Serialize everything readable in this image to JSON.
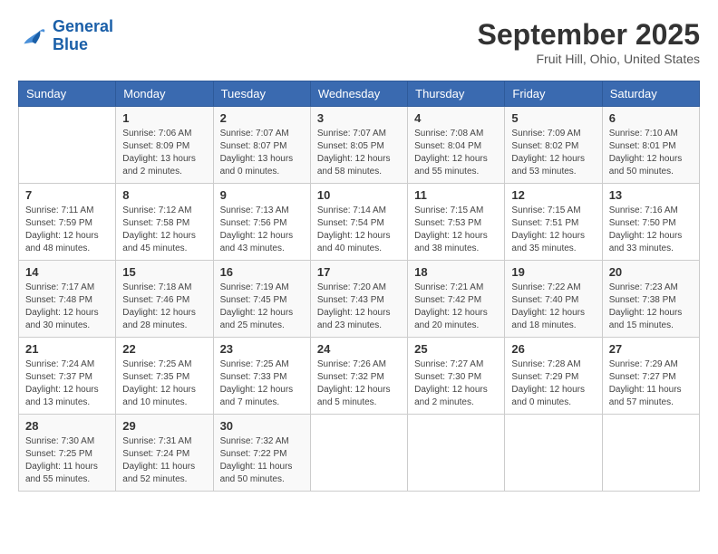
{
  "header": {
    "logo_line1": "General",
    "logo_line2": "Blue",
    "month": "September 2025",
    "location": "Fruit Hill, Ohio, United States"
  },
  "weekdays": [
    "Sunday",
    "Monday",
    "Tuesday",
    "Wednesday",
    "Thursday",
    "Friday",
    "Saturday"
  ],
  "weeks": [
    [
      {
        "day": "",
        "info": ""
      },
      {
        "day": "1",
        "info": "Sunrise: 7:06 AM\nSunset: 8:09 PM\nDaylight: 13 hours\nand 2 minutes."
      },
      {
        "day": "2",
        "info": "Sunrise: 7:07 AM\nSunset: 8:07 PM\nDaylight: 13 hours\nand 0 minutes."
      },
      {
        "day": "3",
        "info": "Sunrise: 7:07 AM\nSunset: 8:05 PM\nDaylight: 12 hours\nand 58 minutes."
      },
      {
        "day": "4",
        "info": "Sunrise: 7:08 AM\nSunset: 8:04 PM\nDaylight: 12 hours\nand 55 minutes."
      },
      {
        "day": "5",
        "info": "Sunrise: 7:09 AM\nSunset: 8:02 PM\nDaylight: 12 hours\nand 53 minutes."
      },
      {
        "day": "6",
        "info": "Sunrise: 7:10 AM\nSunset: 8:01 PM\nDaylight: 12 hours\nand 50 minutes."
      }
    ],
    [
      {
        "day": "7",
        "info": "Sunrise: 7:11 AM\nSunset: 7:59 PM\nDaylight: 12 hours\nand 48 minutes."
      },
      {
        "day": "8",
        "info": "Sunrise: 7:12 AM\nSunset: 7:58 PM\nDaylight: 12 hours\nand 45 minutes."
      },
      {
        "day": "9",
        "info": "Sunrise: 7:13 AM\nSunset: 7:56 PM\nDaylight: 12 hours\nand 43 minutes."
      },
      {
        "day": "10",
        "info": "Sunrise: 7:14 AM\nSunset: 7:54 PM\nDaylight: 12 hours\nand 40 minutes."
      },
      {
        "day": "11",
        "info": "Sunrise: 7:15 AM\nSunset: 7:53 PM\nDaylight: 12 hours\nand 38 minutes."
      },
      {
        "day": "12",
        "info": "Sunrise: 7:15 AM\nSunset: 7:51 PM\nDaylight: 12 hours\nand 35 minutes."
      },
      {
        "day": "13",
        "info": "Sunrise: 7:16 AM\nSunset: 7:50 PM\nDaylight: 12 hours\nand 33 minutes."
      }
    ],
    [
      {
        "day": "14",
        "info": "Sunrise: 7:17 AM\nSunset: 7:48 PM\nDaylight: 12 hours\nand 30 minutes."
      },
      {
        "day": "15",
        "info": "Sunrise: 7:18 AM\nSunset: 7:46 PM\nDaylight: 12 hours\nand 28 minutes."
      },
      {
        "day": "16",
        "info": "Sunrise: 7:19 AM\nSunset: 7:45 PM\nDaylight: 12 hours\nand 25 minutes."
      },
      {
        "day": "17",
        "info": "Sunrise: 7:20 AM\nSunset: 7:43 PM\nDaylight: 12 hours\nand 23 minutes."
      },
      {
        "day": "18",
        "info": "Sunrise: 7:21 AM\nSunset: 7:42 PM\nDaylight: 12 hours\nand 20 minutes."
      },
      {
        "day": "19",
        "info": "Sunrise: 7:22 AM\nSunset: 7:40 PM\nDaylight: 12 hours\nand 18 minutes."
      },
      {
        "day": "20",
        "info": "Sunrise: 7:23 AM\nSunset: 7:38 PM\nDaylight: 12 hours\nand 15 minutes."
      }
    ],
    [
      {
        "day": "21",
        "info": "Sunrise: 7:24 AM\nSunset: 7:37 PM\nDaylight: 12 hours\nand 13 minutes."
      },
      {
        "day": "22",
        "info": "Sunrise: 7:25 AM\nSunset: 7:35 PM\nDaylight: 12 hours\nand 10 minutes."
      },
      {
        "day": "23",
        "info": "Sunrise: 7:25 AM\nSunset: 7:33 PM\nDaylight: 12 hours\nand 7 minutes."
      },
      {
        "day": "24",
        "info": "Sunrise: 7:26 AM\nSunset: 7:32 PM\nDaylight: 12 hours\nand 5 minutes."
      },
      {
        "day": "25",
        "info": "Sunrise: 7:27 AM\nSunset: 7:30 PM\nDaylight: 12 hours\nand 2 minutes."
      },
      {
        "day": "26",
        "info": "Sunrise: 7:28 AM\nSunset: 7:29 PM\nDaylight: 12 hours\nand 0 minutes."
      },
      {
        "day": "27",
        "info": "Sunrise: 7:29 AM\nSunset: 7:27 PM\nDaylight: 11 hours\nand 57 minutes."
      }
    ],
    [
      {
        "day": "28",
        "info": "Sunrise: 7:30 AM\nSunset: 7:25 PM\nDaylight: 11 hours\nand 55 minutes."
      },
      {
        "day": "29",
        "info": "Sunrise: 7:31 AM\nSunset: 7:24 PM\nDaylight: 11 hours\nand 52 minutes."
      },
      {
        "day": "30",
        "info": "Sunrise: 7:32 AM\nSunset: 7:22 PM\nDaylight: 11 hours\nand 50 minutes."
      },
      {
        "day": "",
        "info": ""
      },
      {
        "day": "",
        "info": ""
      },
      {
        "day": "",
        "info": ""
      },
      {
        "day": "",
        "info": ""
      }
    ]
  ]
}
